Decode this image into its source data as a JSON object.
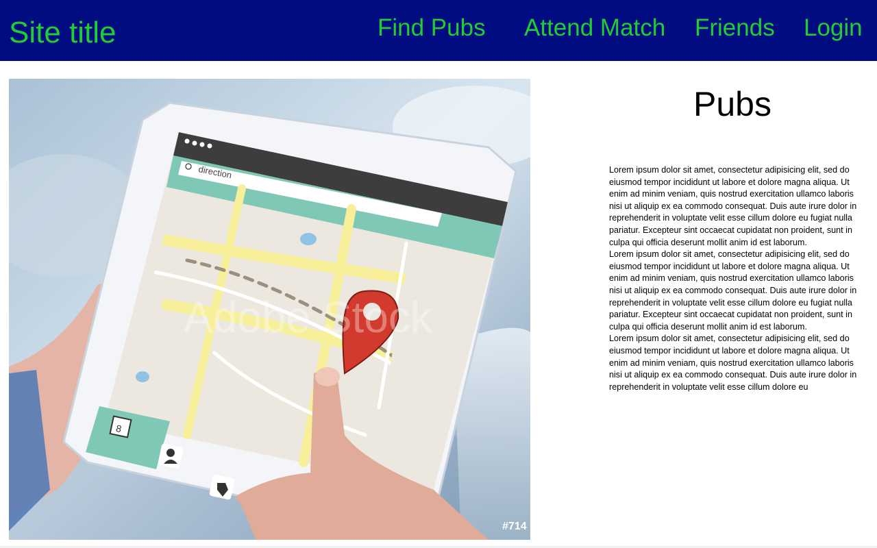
{
  "header": {
    "site_title": "Site title",
    "nav": [
      {
        "label": "Find Pubs"
      },
      {
        "label": "Attend Match"
      },
      {
        "label": "Friends"
      },
      {
        "label": "Login"
      }
    ]
  },
  "hero_image": {
    "search_text": "direction",
    "calendar_day": "8",
    "watermark": "Adobe Stock",
    "stock_id": "#714"
  },
  "main": {
    "heading": "Pubs",
    "paragraphs": [
      "Lorem ipsum dolor sit amet, consectetur adipisicing elit, sed do eiusmod tempor incididunt ut labore et dolore magna aliqua. Ut enim ad minim veniam, quis nostrud exercitation ullamco laboris nisi ut aliquip ex ea commodo consequat. Duis aute irure dolor in reprehenderit in voluptate velit esse cillum dolore eu fugiat nulla pariatur. Excepteur sint occaecat cupidatat non proident, sunt in culpa qui officia deserunt mollit anim id est laborum.",
      "Lorem ipsum dolor sit amet, consectetur adipisicing elit, sed do eiusmod tempor incididunt ut labore et dolore magna aliqua. Ut enim ad minim veniam, quis nostrud exercitation ullamco laboris nisi ut aliquip ex ea commodo consequat. Duis aute irure dolor in reprehenderit in voluptate velit esse cillum dolore eu fugiat nulla pariatur. Excepteur sint occaecat cupidatat non proident, sunt in culpa qui officia deserunt mollit anim id est laborum.",
      "Lorem ipsum dolor sit amet, consectetur adipisicing elit, sed do eiusmod tempor incididunt ut labore et dolore magna aliqua. Ut enim ad minim veniam, quis nostrud exercitation ullamco laboris nisi ut aliquip ex ea commodo consequat. Duis aute irure dolor in reprehenderit in voluptate velit esse cillum dolore eu"
    ]
  },
  "colors": {
    "navbar_bg": "#000c80",
    "nav_text": "#22cc33"
  }
}
